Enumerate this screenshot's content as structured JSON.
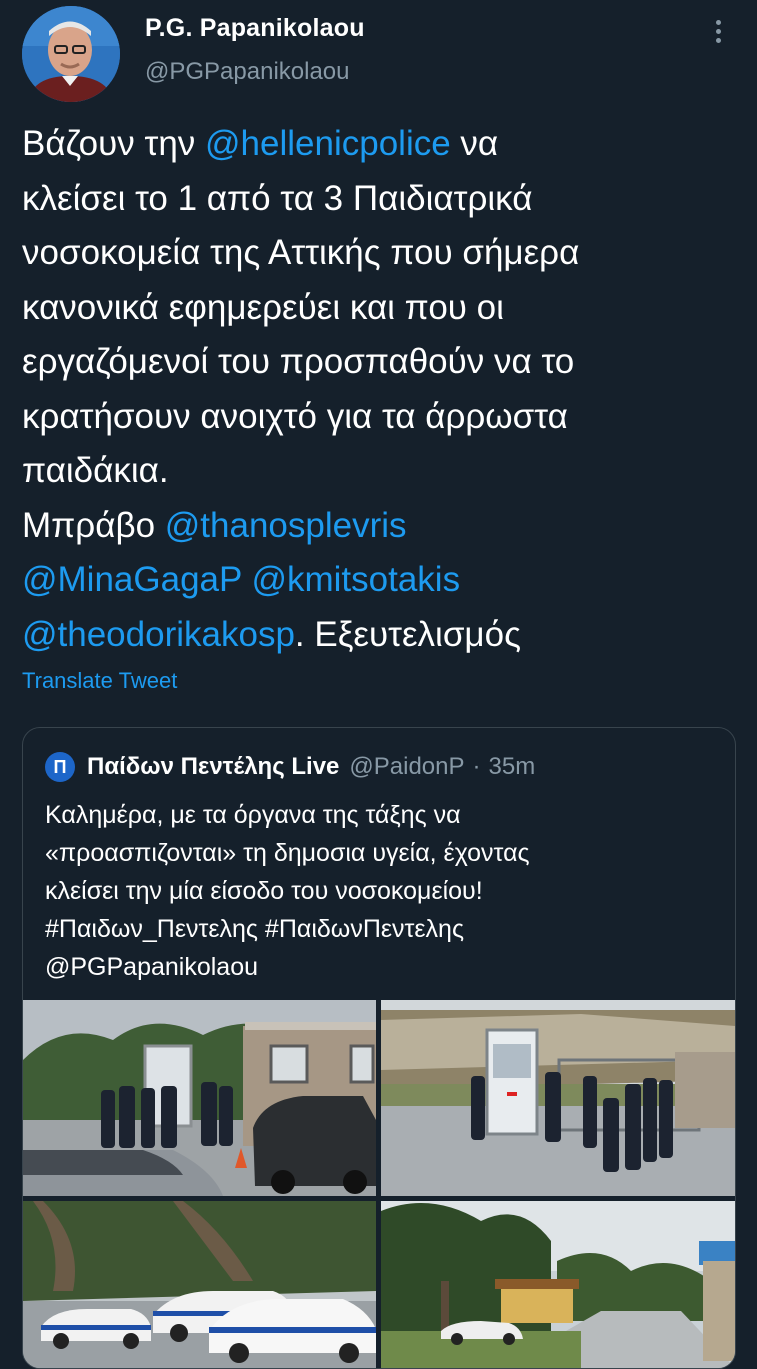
{
  "author": {
    "display_name": "P.G. Papanikolaou",
    "handle": "@PGPapanikolaou"
  },
  "tweet": {
    "lines": [
      [
        {
          "t": "Βάζουν την ",
          "m": false
        },
        {
          "t": "@hellenicpolice",
          "m": true
        },
        {
          "t": " να",
          "m": false
        }
      ],
      [
        {
          "t": "κλείσει το 1 από τα 3 Παιδιατρικά",
          "m": false
        }
      ],
      [
        {
          "t": "νοσοκομεία της Αττικής που σήμερα",
          "m": false
        }
      ],
      [
        {
          "t": "κανονικά εφημερεύει και που οι",
          "m": false
        }
      ],
      [
        {
          "t": "εργαζόμενοί του προσπαθούν να το",
          "m": false
        }
      ],
      [
        {
          "t": "κρατήσουν ανοιχτό για τα άρρωστα",
          "m": false
        }
      ],
      [
        {
          "t": "παιδάκια.",
          "m": false
        }
      ],
      [
        {
          "t": "Μπράβο ",
          "m": false
        },
        {
          "t": "@thanosplevris",
          "m": true
        }
      ],
      [
        {
          "t": "@MinaGagaP",
          "m": true
        },
        {
          "t": " ",
          "m": false
        },
        {
          "t": "@kmitsotakis",
          "m": true
        }
      ],
      [
        {
          "t": "@theodorikakosp",
          "m": true
        },
        {
          "t": ". Εξευτελισμός",
          "m": false
        }
      ]
    ]
  },
  "translate_label": "Translate Tweet",
  "quoted": {
    "avatar_letter": "Π",
    "name": "Παίδων Πεντέλης Live",
    "handle": "@PaidonP",
    "separator": "·",
    "time": "35m",
    "lines": [
      "Καλημέρα, με τα όργανα της τάξης να",
      "«προασπιζονται» τη δημοσια υγεία, έχοντας",
      "κλείσει την μία είσοδο του νοσοκομείου!",
      "#Παιδων_Πεντελης #ΠαιδωνΠεντελης",
      "@PGPapanikolaou"
    ],
    "photos": [
      "photo-1",
      "photo-2",
      "photo-3",
      "photo-4"
    ]
  },
  "colors": {
    "background": "#15202b",
    "accent": "#1d9bf0",
    "secondary_text": "#8899a6",
    "border": "#38444d"
  },
  "icons": {
    "more": "more-vertical-icon"
  }
}
